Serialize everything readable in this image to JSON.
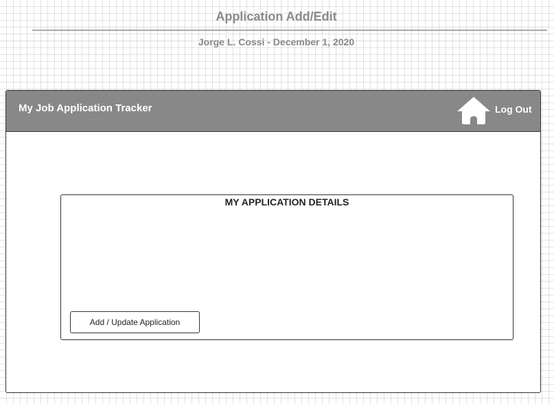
{
  "document": {
    "title": "Application Add/Edit",
    "subtitle": "Jorge L. Cossi - December 1, 2020"
  },
  "header": {
    "app_title": "My Job Application Tracker",
    "home_icon": "home-icon",
    "logout_label": "Log Out"
  },
  "details": {
    "heading": "MY APPLICATION DETAILS",
    "submit_label": "Add / Update Application"
  },
  "colors": {
    "header_bg": "#888888",
    "header_text": "#ffffff",
    "doc_text": "#8a8a8a",
    "border": "#333333"
  }
}
